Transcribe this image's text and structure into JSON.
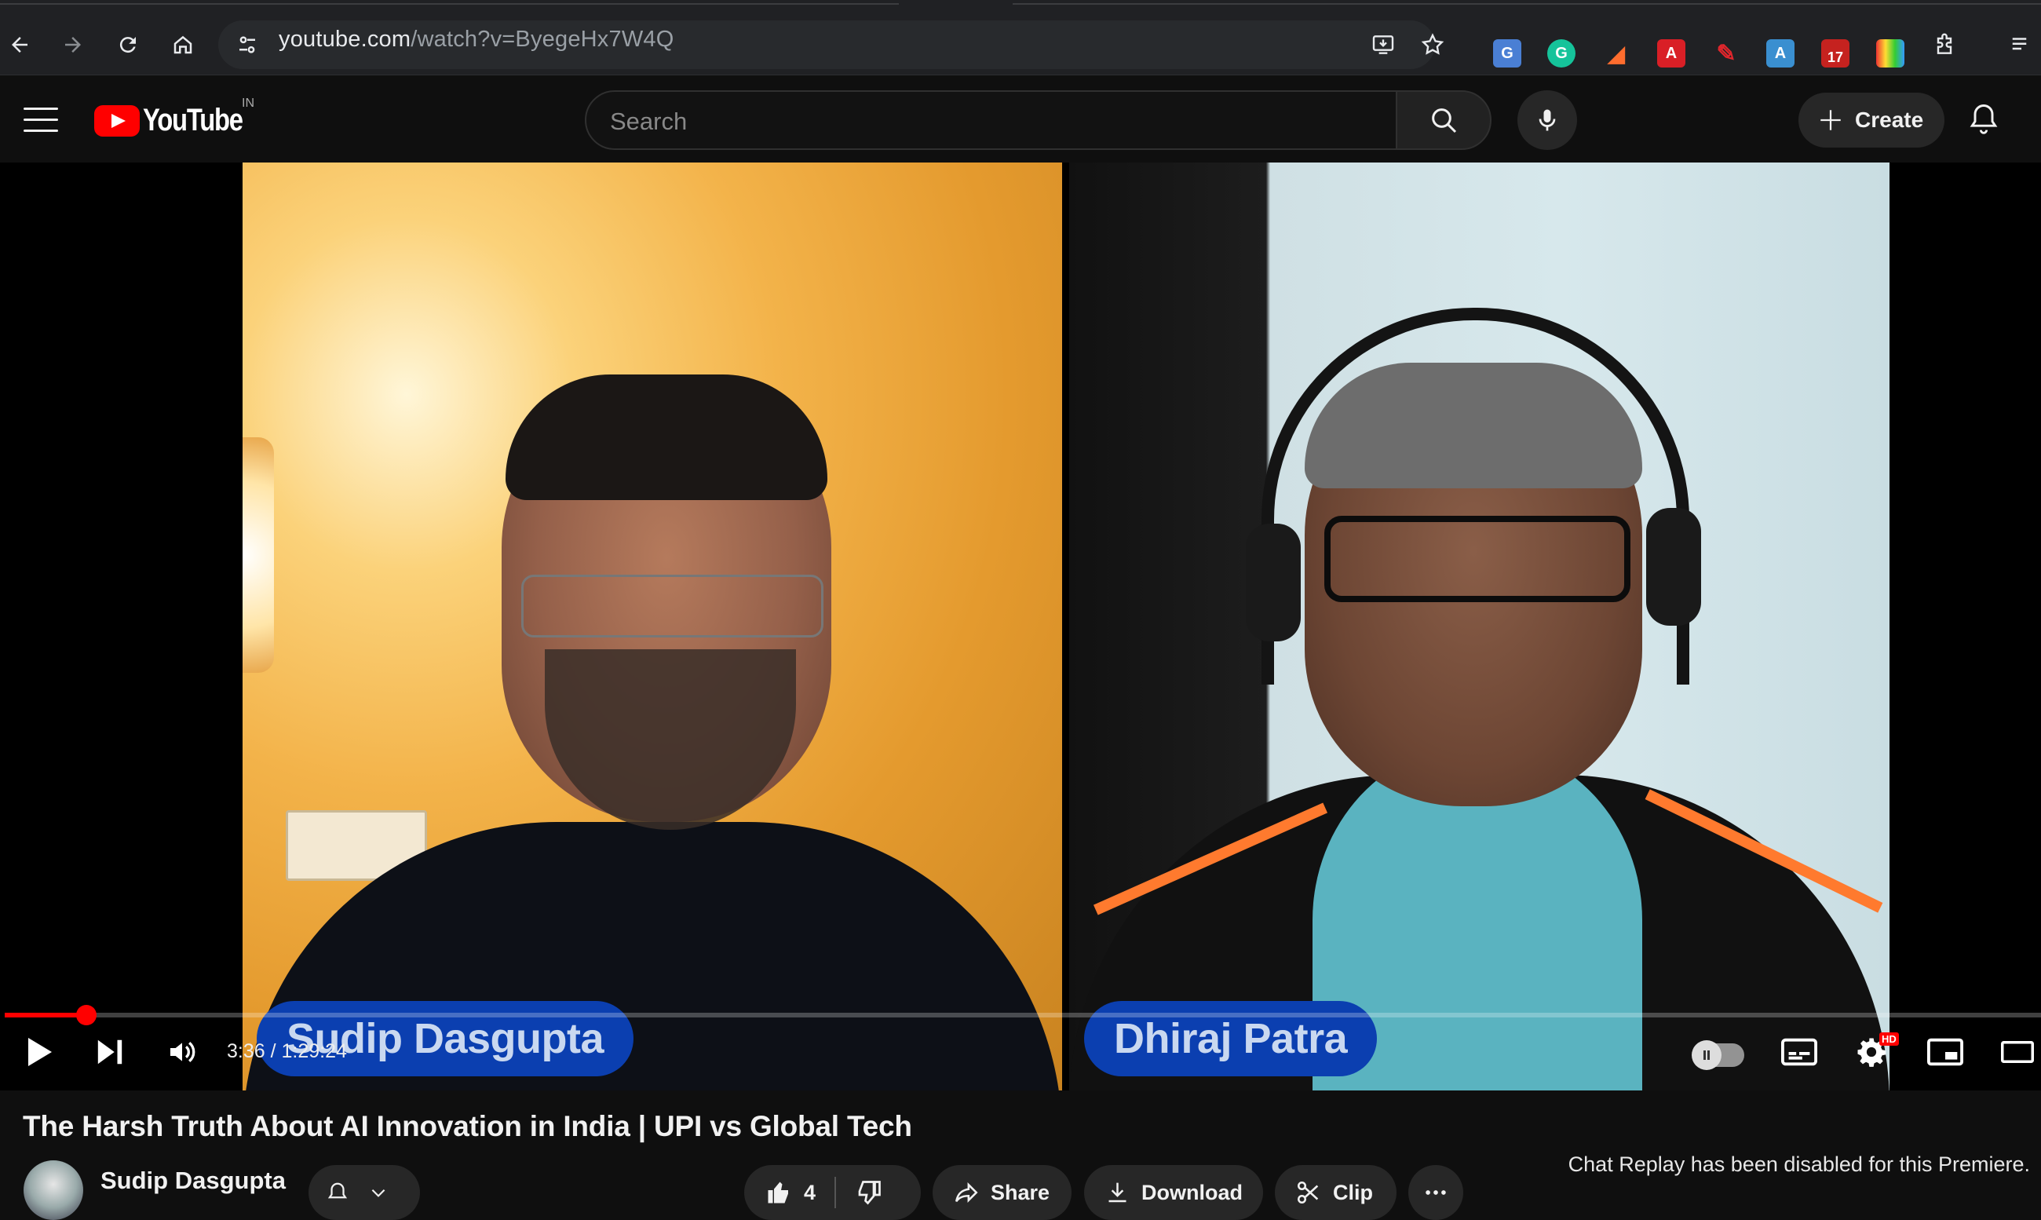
{
  "browser": {
    "url_host": "youtube.com",
    "url_path": "/watch?v=ByegeHx7W4Q",
    "mail_badge_count": "17"
  },
  "youtube": {
    "logo_text": "YouTube",
    "country_code": "IN",
    "search_placeholder": "Search",
    "create_label": "Create"
  },
  "video": {
    "left_speaker": "Sudip Dasgupta",
    "right_speaker": "Dhiraj Patra",
    "time_display": "3:36 / 1:29:24",
    "progress_fraction": 0.04,
    "hd_badge": "HD"
  },
  "info": {
    "title": "The Harsh Truth About AI Innovation in India | UPI vs Global Tech",
    "channel_name": "Sudip Dasgupta",
    "like_count": "4",
    "share_label": "Share",
    "download_label": "Download",
    "clip_label": "Clip",
    "chat_note": "Chat Replay has been disabled for this Premiere."
  },
  "colors": {
    "accent_red": "#ff0000",
    "name_tag_blue": "#0b3fb0"
  }
}
